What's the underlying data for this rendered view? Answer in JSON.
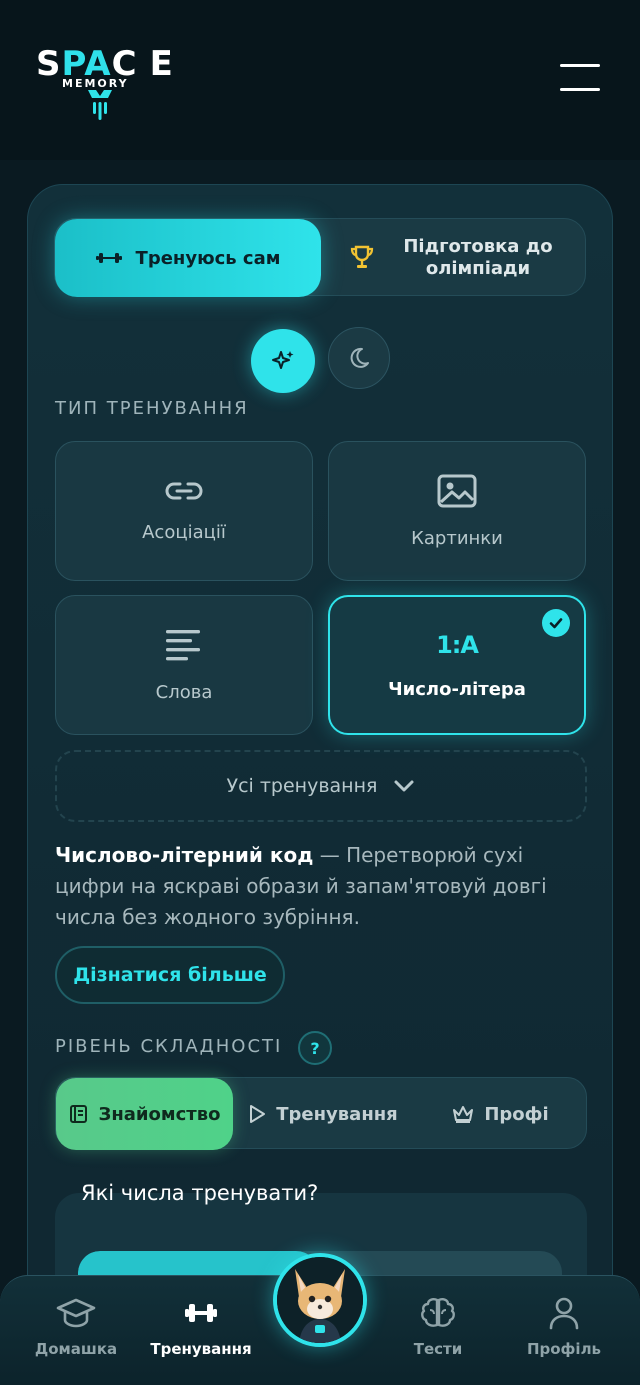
{
  "header": {
    "logo_lines": [
      "SPACE",
      "MEMORY"
    ]
  },
  "mode_toggle": {
    "self_label": "Тренуюсь сам",
    "olympiad_label": "Підготовка до олімпіади"
  },
  "training_type": {
    "section_label": "ТИП ТРЕНУВАННЯ",
    "tiles": [
      {
        "label": "Асоціації",
        "icon": "link-icon"
      },
      {
        "label": "Картинки",
        "icon": "image-icon"
      },
      {
        "label": "Слова",
        "icon": "text-lines-icon"
      },
      {
        "label": "Число-літера",
        "icon": "number-letter-icon",
        "glyph": "1:A",
        "selected": true
      }
    ],
    "all_trainings_label": "Усі тренування"
  },
  "description": {
    "title": "Числово-літерний код",
    "text": " — Перетворюй сухі цифри на яскраві образи й запам'ятовуй довгі числа без жодного зубріння."
  },
  "learn_more_label": "Дізнатися більше",
  "difficulty": {
    "section_label": "РІВЕНЬ СКЛАДНОСТІ",
    "help_glyph": "?",
    "levels": [
      {
        "label": "Знайомство",
        "icon": "book-icon",
        "active": true
      },
      {
        "label": "Тренування",
        "icon": "play-icon"
      },
      {
        "label": "Профі",
        "icon": "crown-icon"
      }
    ]
  },
  "numbers": {
    "title": "Які числа тренувати?"
  },
  "bottom_nav": {
    "items": [
      {
        "label": "Домашка",
        "icon": "graduation-cap-icon"
      },
      {
        "label": "Тренування",
        "icon": "dumbbell-icon",
        "active": true
      },
      {
        "label": "Тести",
        "icon": "brain-icon"
      },
      {
        "label": "Профіль",
        "icon": "user-icon"
      }
    ]
  },
  "colors": {
    "accent": "#2fe3ea",
    "level_active": "#58c98a",
    "background": "#0a1a21"
  }
}
